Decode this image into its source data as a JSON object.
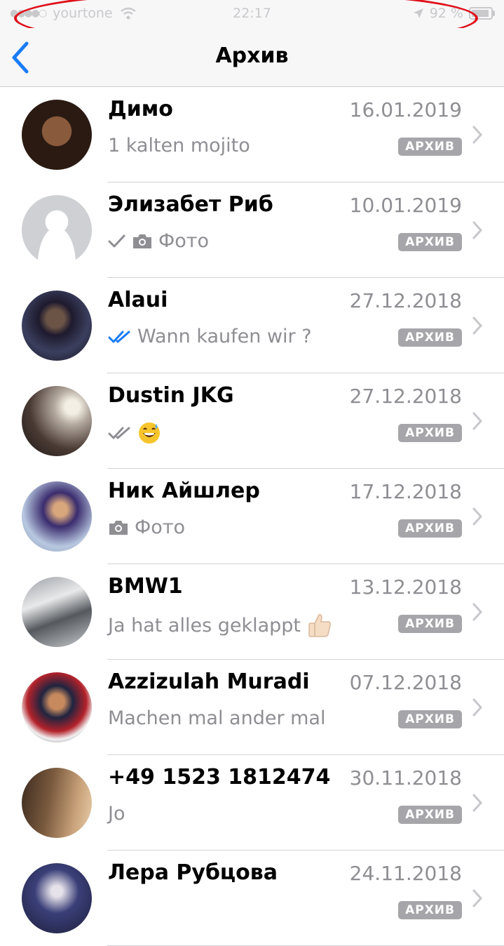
{
  "status_bar": {
    "carrier": "yourtone",
    "time": "22:17",
    "battery": "92 %",
    "battery_level": 0.92
  },
  "nav": {
    "back_icon": "chevron-left-icon",
    "title": "Архив"
  },
  "badge_label": "АРХИВ",
  "colors": {
    "accent": "#1a7cf5",
    "annotation": "#e0101a",
    "secondary_text": "#8e8e93",
    "badge": "#a6a6aa"
  },
  "chats": [
    {
      "name": "Димо",
      "date": "16.01.2019",
      "preview": "1 kalten mojito",
      "status": "none",
      "attachment": "none",
      "emoji": "none"
    },
    {
      "name": "Элизабет Риб",
      "date": "10.01.2019",
      "preview": "Фото",
      "status": "sent",
      "attachment": "camera",
      "emoji": "none"
    },
    {
      "name": "Alaui",
      "date": "27.12.2018",
      "preview": "Wann kaufen wir ?",
      "status": "read",
      "attachment": "none",
      "emoji": "none"
    },
    {
      "name": "Dustin JKG",
      "date": "27.12.2018",
      "preview": "",
      "status": "delivered",
      "attachment": "none",
      "emoji": "grinning-sweat"
    },
    {
      "name": "Ник Айшлер",
      "date": "17.12.2018",
      "preview": "Фото",
      "status": "none",
      "attachment": "camera",
      "emoji": "none"
    },
    {
      "name": "BMW1",
      "date": "13.12.2018",
      "preview": "Ja hat alles geklappt",
      "status": "none",
      "attachment": "none",
      "emoji": "thumbs-up"
    },
    {
      "name": "Azzizulah Muradi",
      "date": "07.12.2018",
      "preview": "Machen mal ander mal",
      "status": "none",
      "attachment": "none",
      "emoji": "none"
    },
    {
      "name": "+49 1523 1812474",
      "date": "30.11.2018",
      "preview": "Jo",
      "status": "none",
      "attachment": "none",
      "emoji": "none"
    },
    {
      "name": "Лера  Рубцова",
      "date": "24.11.2018",
      "preview": "",
      "status": "none",
      "attachment": "none",
      "emoji": "none"
    }
  ]
}
